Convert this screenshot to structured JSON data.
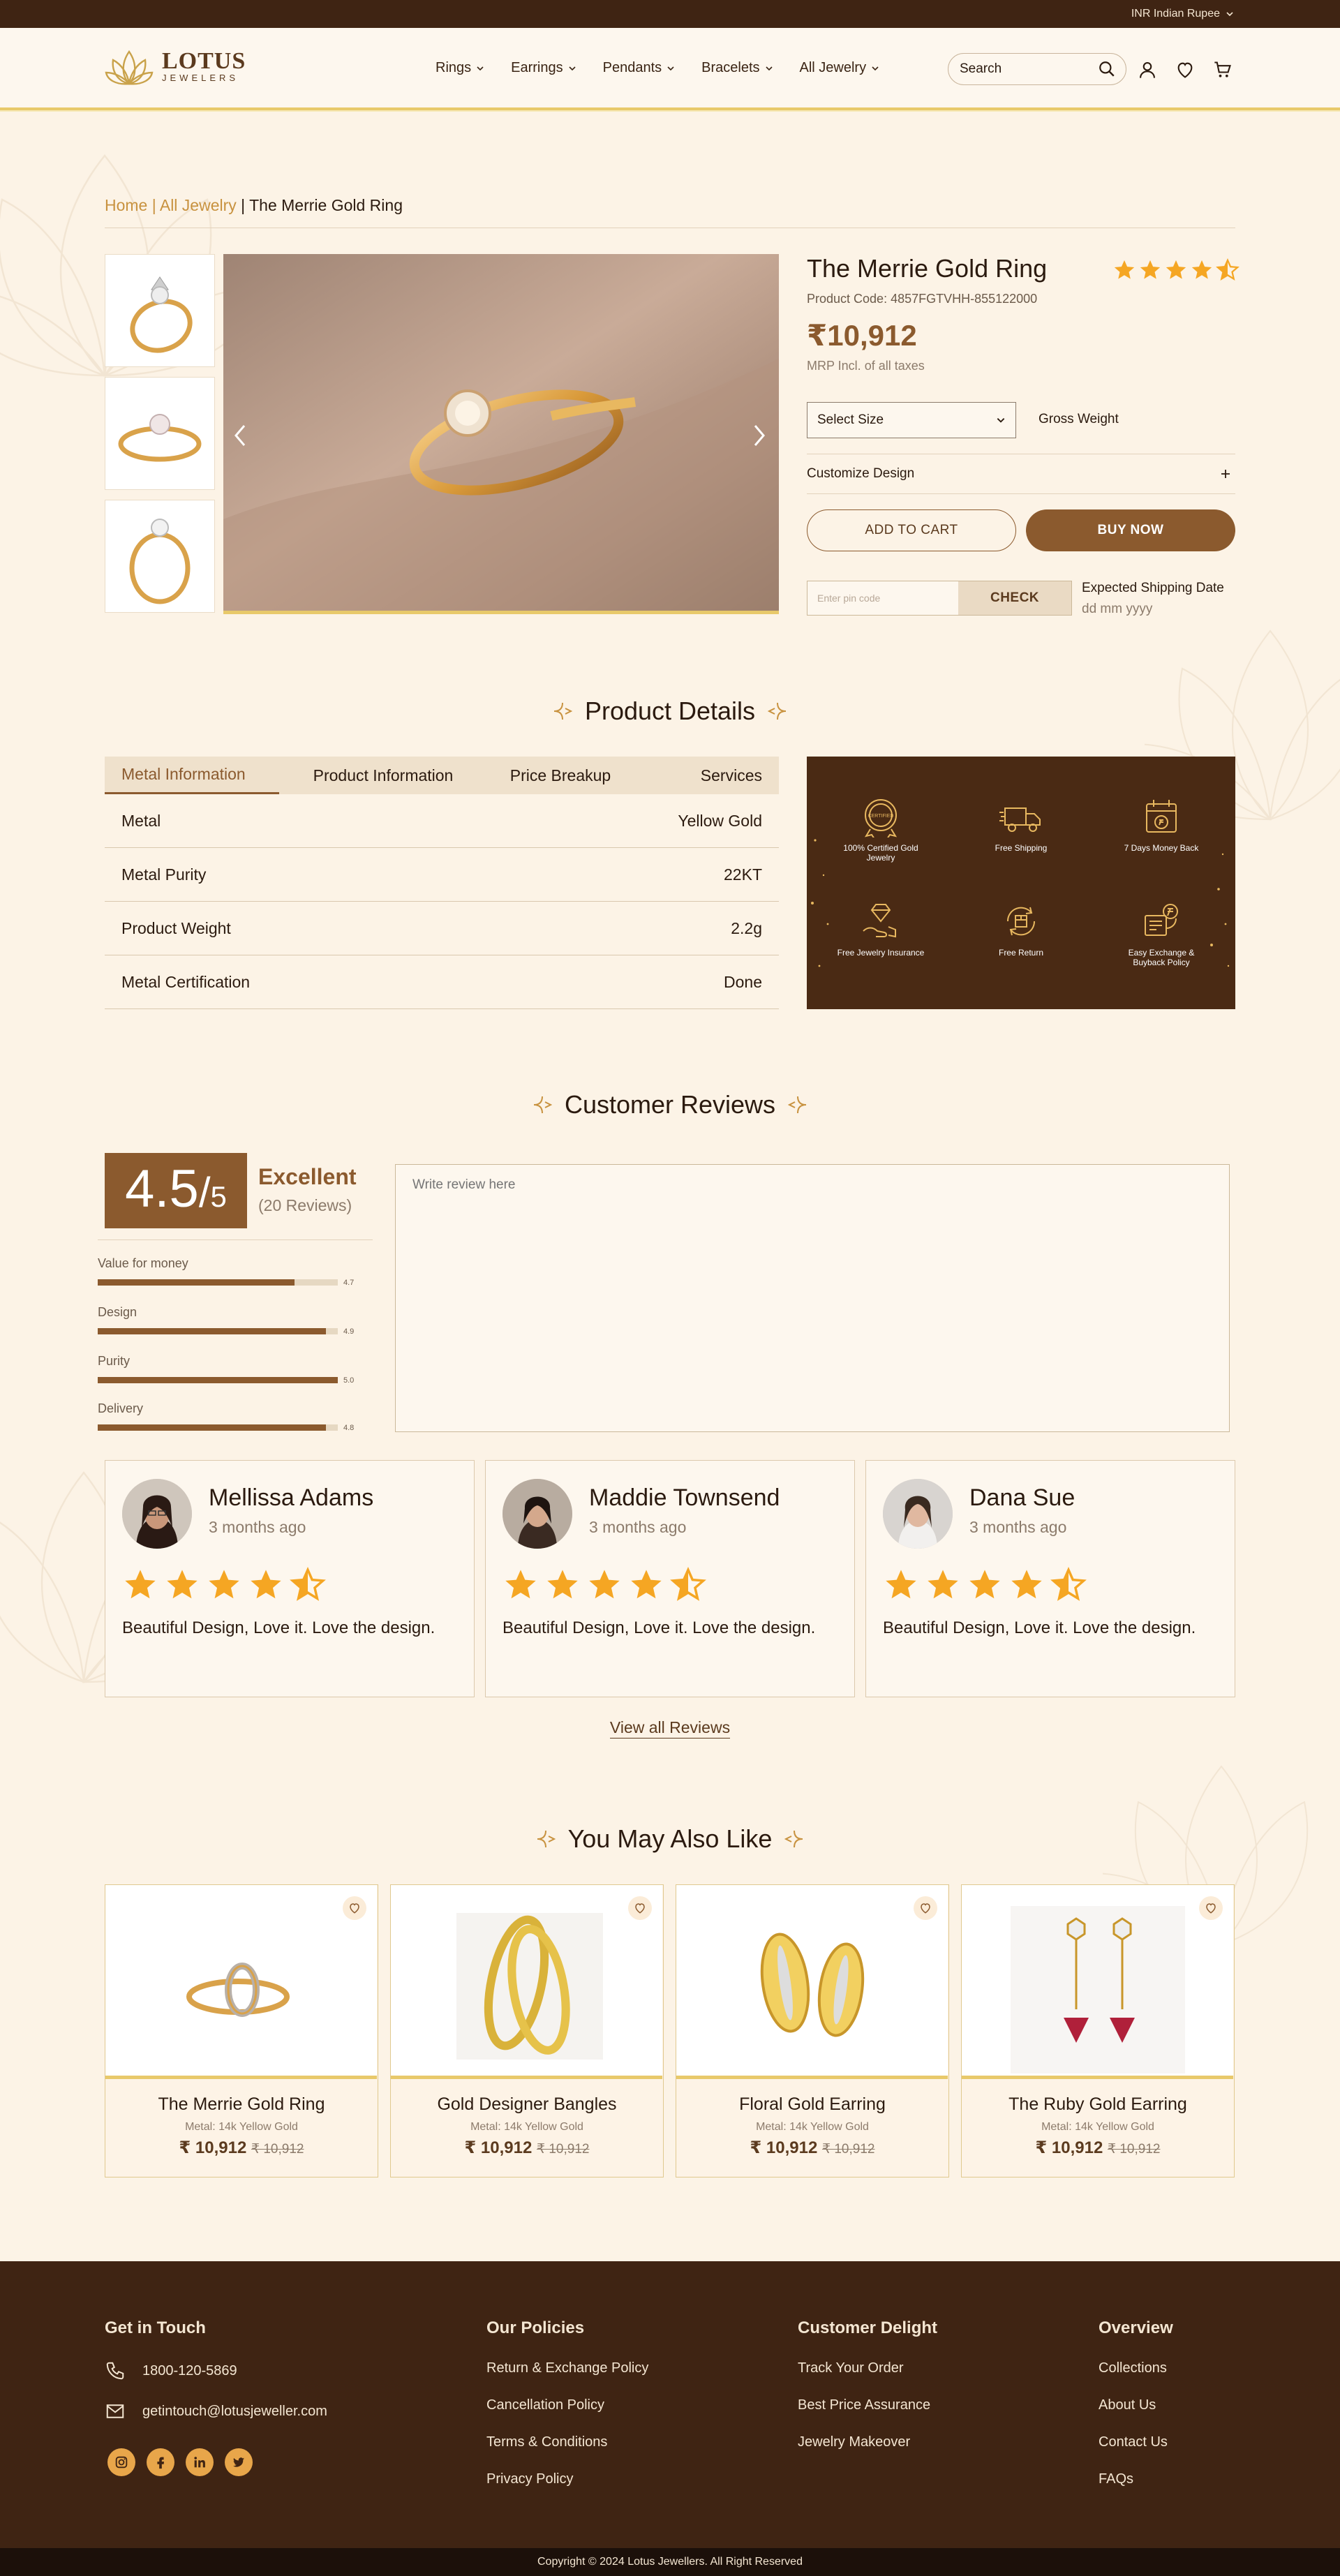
{
  "topbar": {
    "currency": "INR Indian Rupee"
  },
  "brand": {
    "name": "LOTUS",
    "tagline": "JEWELERS"
  },
  "nav": [
    {
      "label": "Rings"
    },
    {
      "label": "Earrings"
    },
    {
      "label": "Pendants"
    },
    {
      "label": "Bracelets"
    },
    {
      "label": "All Jewelry"
    }
  ],
  "search": {
    "placeholder": "Search"
  },
  "breadcrumb": {
    "home": "Home",
    "sep": " | ",
    "category": "All Jewelry",
    "current": "The Merrie Gold Ring"
  },
  "product": {
    "title": "The Merrie Gold Ring",
    "rating": 4.5,
    "code": "Product Code: 4857FGTVHH-855122000",
    "price": "₹10,912",
    "mrp_note": "MRP Incl. of all taxes",
    "select_size": "Select Size",
    "gross_weight": "Gross Weight",
    "customize": "Customize Design",
    "add_to_cart": "ADD TO CART",
    "buy_now": "BUY NOW",
    "pin_placeholder": "Enter pin code",
    "check": "CHECK",
    "shipping_title": "Expected Shipping Date",
    "shipping_date": "dd mm yyyy"
  },
  "details": {
    "title": "Product Details",
    "tabs": [
      "Metal Information",
      "Product Information",
      "Price Breakup",
      "Services"
    ],
    "rows": [
      {
        "label": "Metal",
        "value": "Yellow Gold"
      },
      {
        "label": "Metal Purity",
        "value": "22KT"
      },
      {
        "label": "Product Weight",
        "value": "2.2g"
      },
      {
        "label": "Metal Certification",
        "value": "Done"
      }
    ],
    "services": [
      {
        "label": "100% Certified Gold Jewelry",
        "icon": "certified-icon"
      },
      {
        "label": "Free Shipping",
        "icon": "truck-icon"
      },
      {
        "label": "7 Days Money Back",
        "icon": "calendar-money-icon"
      },
      {
        "label": "Free Jewelry Insurance",
        "icon": "insurance-icon"
      },
      {
        "label": "Free Return",
        "icon": "return-icon"
      },
      {
        "label": "Easy Exchange & Buyback Policy",
        "icon": "exchange-icon"
      }
    ]
  },
  "reviews": {
    "title": "Customer Reviews",
    "score": "4.5",
    "score_of": "5",
    "verdict": "Excellent",
    "count": "(20 Reviews)",
    "metrics": [
      {
        "label": "Value for money",
        "value": "4.7",
        "fraction": 0.82
      },
      {
        "label": "Design",
        "value": "4.9",
        "fraction": 0.95
      },
      {
        "label": "Purity",
        "value": "5.0",
        "fraction": 1.0
      },
      {
        "label": "Delivery",
        "value": "4.8",
        "fraction": 0.95
      }
    ],
    "write_placeholder": "Write review here",
    "items": [
      {
        "name": "Mellissa Adams",
        "time": "3 months ago",
        "rating": 4.5,
        "text": "Beautiful Design, Love it. Love the design."
      },
      {
        "name": "Maddie Townsend",
        "time": "3 months ago",
        "rating": 4.5,
        "text": "Beautiful Design, Love it. Love the design."
      },
      {
        "name": "Dana Sue",
        "time": "3 months ago",
        "rating": 4.5,
        "text": "Beautiful Design, Love it. Love the design."
      }
    ],
    "view_all": "View all Reviews"
  },
  "related": {
    "title": "You May Also Like",
    "items": [
      {
        "name": "The Merrie Gold Ring",
        "metal": "Metal: 14k Yellow Gold",
        "price": "₹ 10,912",
        "old_price": "₹ 10,912"
      },
      {
        "name": "Gold Designer Bangles",
        "metal": "Metal: 14k Yellow Gold",
        "price": "₹ 10,912",
        "old_price": "₹ 10,912"
      },
      {
        "name": "Floral Gold Earring",
        "metal": "Metal: 14k Yellow Gold",
        "price": "₹ 10,912",
        "old_price": "₹ 10,912"
      },
      {
        "name": "The Ruby Gold Earring",
        "metal": "Metal: 14k Yellow Gold",
        "price": "₹ 10,912",
        "old_price": "₹ 10,912"
      }
    ]
  },
  "footer": {
    "get_in_touch": "Get in Touch",
    "phone": "1800-120-5869",
    "email": "getintouch@lotusjeweller.com",
    "policies_title": "Our Policies",
    "policies": [
      "Return & Exchange Policy",
      "Cancellation Policy",
      "Terms & Conditions",
      "Privacy Policy"
    ],
    "delight_title": "Customer Delight",
    "delight": [
      "Track Your Order",
      "Best Price Assurance",
      "Jewelry Makeover"
    ],
    "overview_title": "Overview",
    "overview": [
      "Collections",
      "About Us",
      "Contact Us",
      "FAQs"
    ],
    "copyright": "Copyright © 2024 Lotus Jewellers. All Right Reserved"
  },
  "colors": {
    "brand_brown": "#8b5a2e",
    "dark_brown": "#3f2413",
    "gold": "#e8c96a",
    "cream": "#fcf3e6",
    "star": "#f5a623"
  }
}
